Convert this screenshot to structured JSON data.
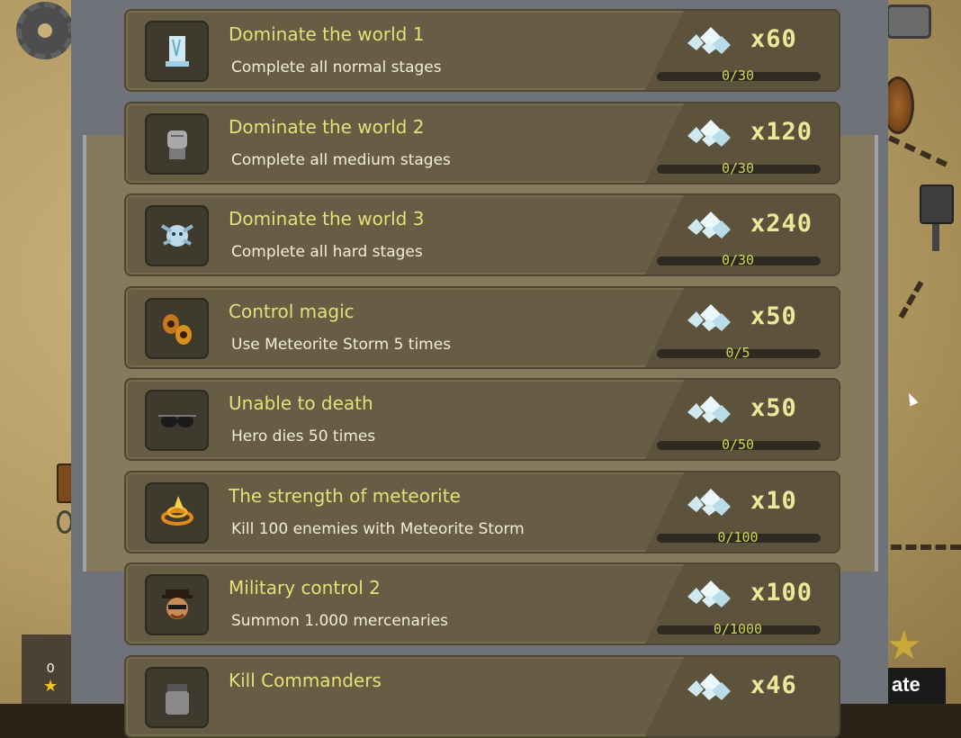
{
  "background": {
    "stars_count": "0",
    "star_icon": "★",
    "action_button_label": "ate"
  },
  "achievements": [
    {
      "title": "Dominate the world 1",
      "description": "Complete all normal stages",
      "reward": "x60",
      "progress": "0/30",
      "progress_value": 0,
      "progress_max": 30,
      "icon": "ice-tower-icon"
    },
    {
      "title": "Dominate the world 2",
      "description": "Complete all medium stages",
      "reward": "x120",
      "progress": "0/30",
      "progress_value": 0,
      "progress_max": 30,
      "icon": "stone-fist-icon"
    },
    {
      "title": "Dominate the world 3",
      "description": "Complete all hard stages",
      "reward": "x240",
      "progress": "0/30",
      "progress_value": 0,
      "progress_max": 30,
      "icon": "frost-demon-icon"
    },
    {
      "title": "Control magic",
      "description": "Use Meteorite Storm 5 times",
      "reward": "x50",
      "progress": "0/5",
      "progress_value": 0,
      "progress_max": 5,
      "icon": "meteorite-icon"
    },
    {
      "title": "Unable to death",
      "description": "Hero dies 50 times",
      "reward": "x50",
      "progress": "0/50",
      "progress_value": 0,
      "progress_max": 50,
      "icon": "sunglasses-icon"
    },
    {
      "title": "The strength of meteorite",
      "description": "Kill 100 enemies with Meteorite Storm",
      "reward": "x10",
      "progress": "0/100",
      "progress_value": 0,
      "progress_max": 100,
      "icon": "fire-swirl-icon"
    },
    {
      "title": "Military control 2",
      "description": "Summon 1.000 mercenaries",
      "reward": "x100",
      "progress": "0/1000",
      "progress_value": 0,
      "progress_max": 1000,
      "icon": "bandit-head-icon"
    },
    {
      "title": "Kill Commanders",
      "description": "",
      "reward": "x46",
      "progress": "",
      "progress_value": 0,
      "progress_max": 0,
      "icon": "jar-icon"
    }
  ],
  "reward_icon": "diamond-gems-icon",
  "colors": {
    "title": "#e7df7a",
    "description": "#f3ecd6",
    "reward": "#efe69a",
    "progress": "#cfd64a",
    "row_bg": "#675c44"
  }
}
